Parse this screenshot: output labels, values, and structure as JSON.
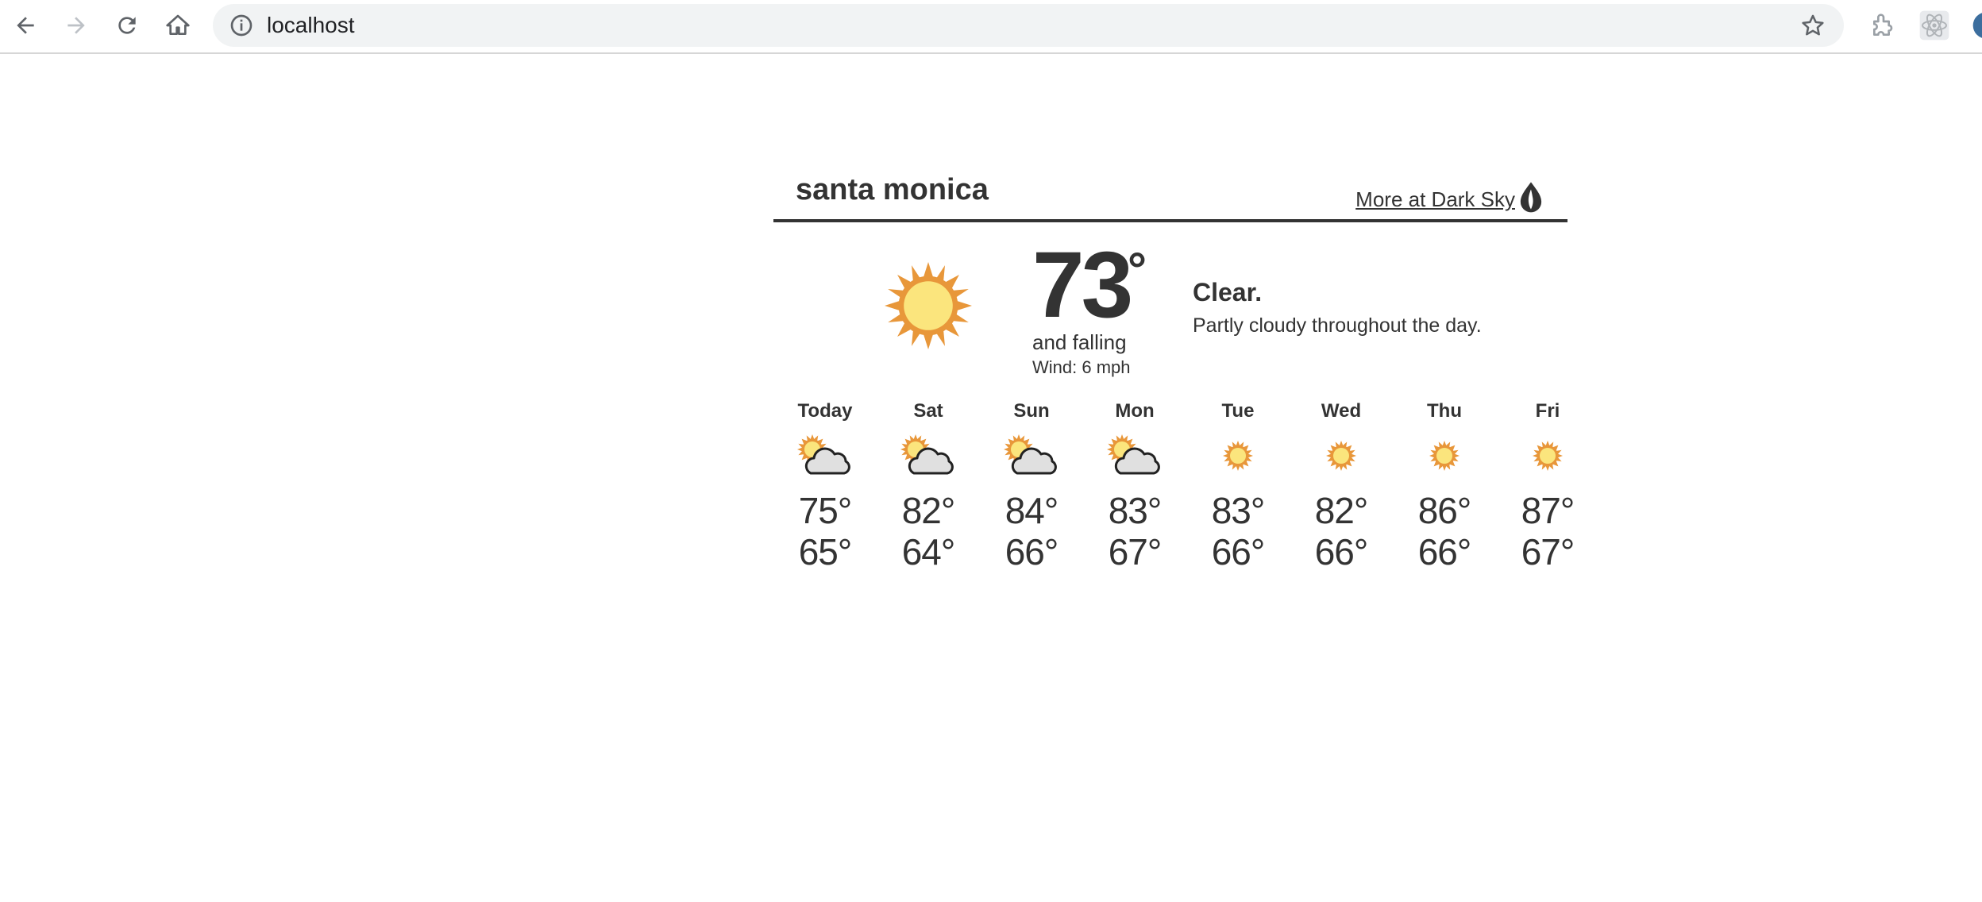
{
  "browser": {
    "url": "localhost"
  },
  "widget": {
    "location": "santa monica",
    "link_text": "More at Dark Sky",
    "current": {
      "temperature": "73",
      "degree": "°",
      "trend": "and falling",
      "wind": "Wind: 6 mph",
      "summary": "Clear.",
      "description": "Partly cloudy throughout the day.",
      "icon": "clear-day-icon"
    },
    "forecast": [
      {
        "label": "Today",
        "high": "75°",
        "low": "65°",
        "icon": "partly-cloudy-day-icon"
      },
      {
        "label": "Sat",
        "high": "82°",
        "low": "64°",
        "icon": "partly-cloudy-day-icon"
      },
      {
        "label": "Sun",
        "high": "84°",
        "low": "66°",
        "icon": "partly-cloudy-day-icon"
      },
      {
        "label": "Mon",
        "high": "83°",
        "low": "67°",
        "icon": "partly-cloudy-day-icon"
      },
      {
        "label": "Tue",
        "high": "83°",
        "low": "66°",
        "icon": "clear-day-icon"
      },
      {
        "label": "Wed",
        "high": "82°",
        "low": "66°",
        "icon": "clear-day-icon"
      },
      {
        "label": "Thu",
        "high": "86°",
        "low": "66°",
        "icon": "clear-day-icon"
      },
      {
        "label": "Fri",
        "high": "87°",
        "low": "67°",
        "icon": "clear-day-icon"
      }
    ]
  },
  "colors": {
    "text": "#333333",
    "sun_ray": "#e8973a",
    "sun_core": "#fbe57d",
    "cloud": "#e0e0e0",
    "omnibox": "#f1f3f4"
  }
}
